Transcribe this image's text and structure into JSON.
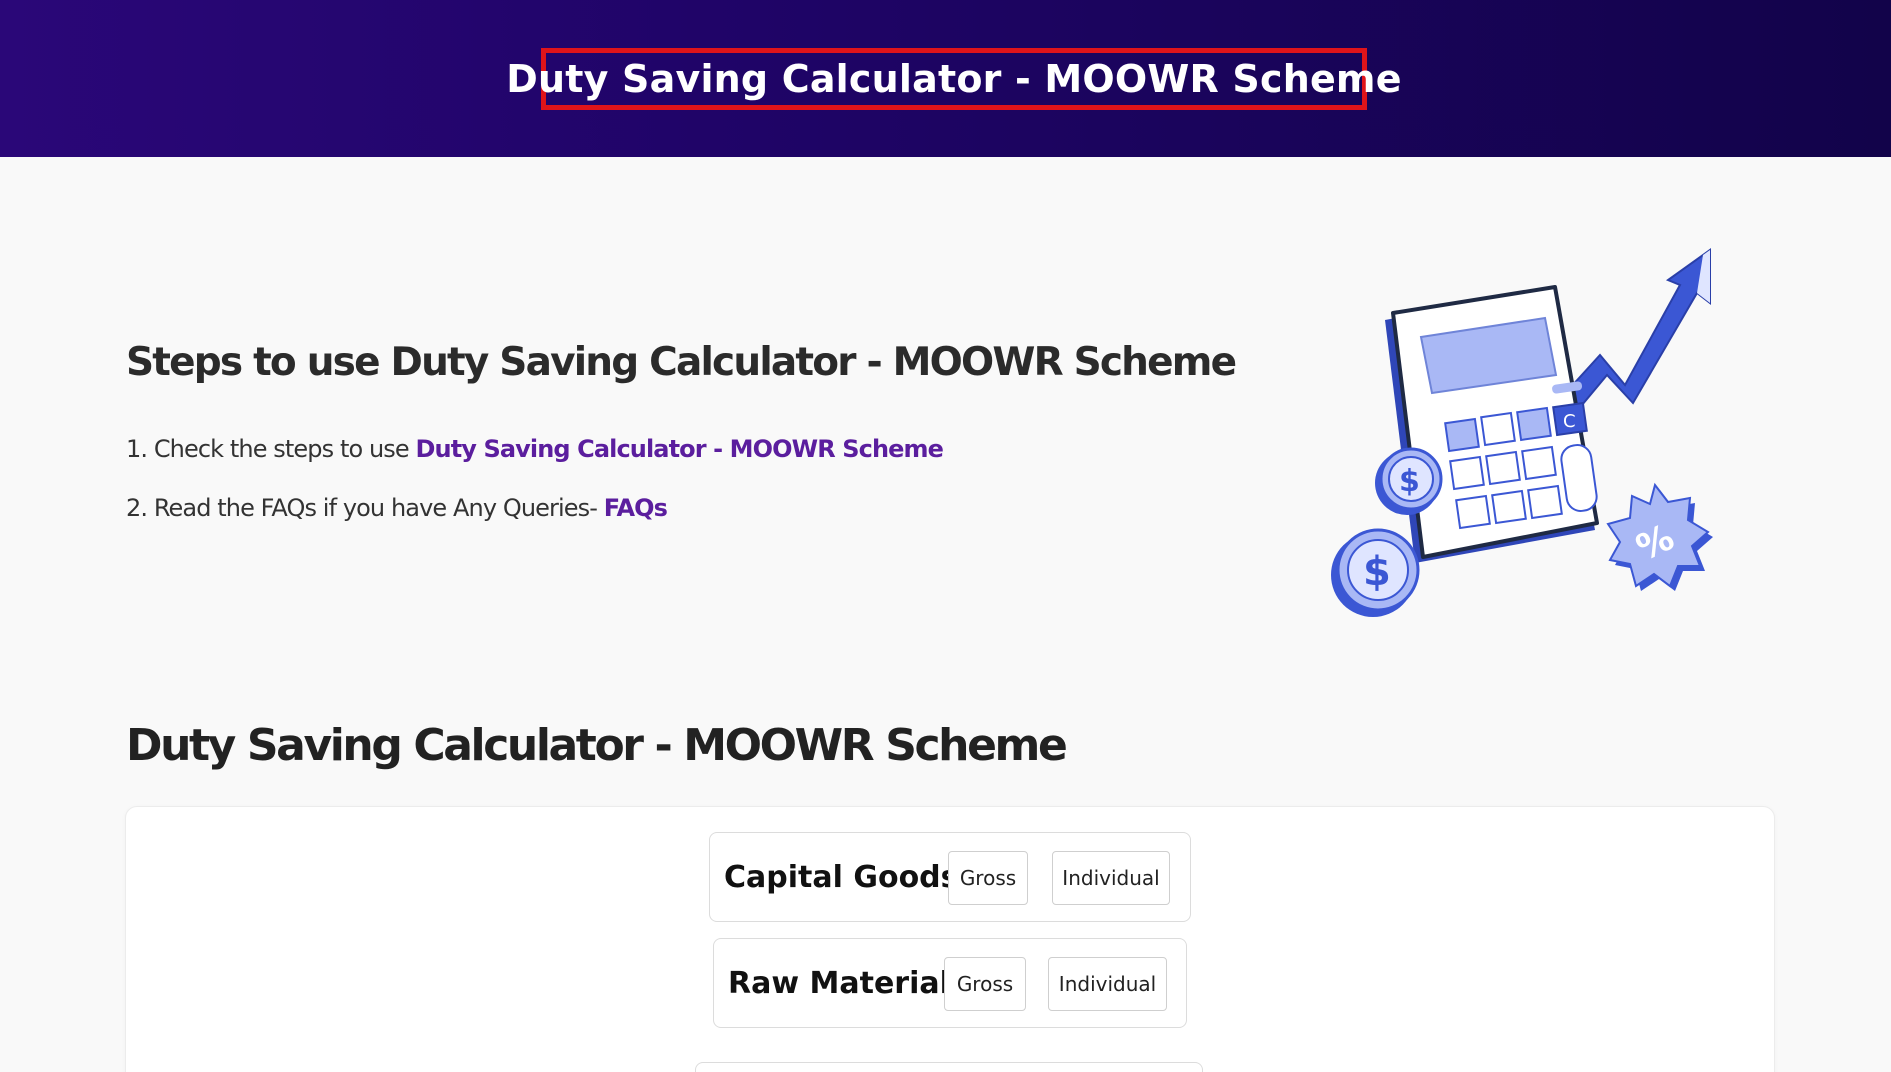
{
  "header": {
    "title": "Duty Saving Calculator - MOOWR Scheme"
  },
  "steps": {
    "heading": "Steps to use Duty Saving Calculator - MOOWR Scheme",
    "items": [
      {
        "prefix": "1. Check the steps to use ",
        "link": "Duty Saving Calculator - MOOWR Scheme"
      },
      {
        "prefix": "2. Read the FAQs if you have Any Queries- ",
        "link": "FAQs"
      }
    ]
  },
  "illustration": {
    "icon": "calculator-growth-illustration",
    "calc_key_label": "C"
  },
  "calculator": {
    "heading": "Duty Saving Calculator - MOOWR Scheme",
    "rows": [
      {
        "label": "Capital Goods",
        "options": [
          "Gross",
          "Individual"
        ]
      },
      {
        "label": "Raw Material",
        "options": [
          "Gross",
          "Individual"
        ]
      }
    ]
  },
  "colors": {
    "banner_start": "#2a0778",
    "banner_end": "#12034a",
    "highlight_border": "#e0141a",
    "link": "#5b1e9e",
    "illustration_blue": "#3b57d4",
    "illustration_light": "#a9b8f5"
  }
}
